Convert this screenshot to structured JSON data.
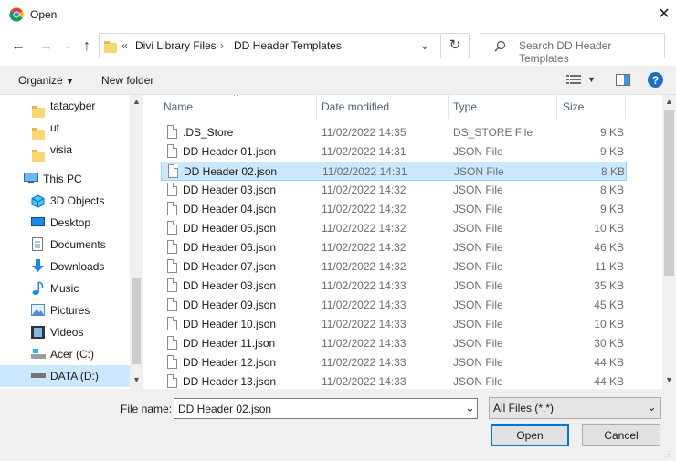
{
  "window": {
    "title": "Open",
    "close_glyph": "✕"
  },
  "nav": {
    "back": "←",
    "forward": "→",
    "up": "↑"
  },
  "address": {
    "overflow": "«",
    "segments": [
      "Divi Library Files",
      "DD Header Templates"
    ],
    "separator": "›",
    "dropdown": "⌄",
    "refresh": "↻"
  },
  "search": {
    "placeholder": "Search DD Header Templates"
  },
  "toolbar": {
    "organize": "Organize",
    "new_folder": "New folder",
    "help": "?"
  },
  "sidebar": {
    "items": [
      {
        "label": "tatacyber",
        "icon": "folder-icon"
      },
      {
        "label": "ut",
        "icon": "folder-icon"
      },
      {
        "label": "visia",
        "icon": "folder-icon"
      },
      {
        "label": "This PC",
        "icon": "computer-icon"
      },
      {
        "label": "3D Objects",
        "icon": "3d-objects-icon"
      },
      {
        "label": "Desktop",
        "icon": "desktop-icon"
      },
      {
        "label": "Documents",
        "icon": "documents-icon"
      },
      {
        "label": "Downloads",
        "icon": "downloads-icon"
      },
      {
        "label": "Music",
        "icon": "music-icon"
      },
      {
        "label": "Pictures",
        "icon": "pictures-icon"
      },
      {
        "label": "Videos",
        "icon": "videos-icon"
      },
      {
        "label": "Acer (C:)",
        "icon": "drive-icon"
      },
      {
        "label": "DATA (D:)",
        "icon": "drive-icon",
        "selected": true
      }
    ]
  },
  "columns": {
    "name": "Name",
    "date": "Date modified",
    "type": "Type",
    "size": "Size"
  },
  "files": [
    {
      "name": ".DS_Store",
      "date": "11/02/2022 14:35",
      "type": "DS_STORE File",
      "size": "9 KB"
    },
    {
      "name": "DD Header 01.json",
      "date": "11/02/2022 14:31",
      "type": "JSON File",
      "size": "9 KB"
    },
    {
      "name": "DD Header 02.json",
      "date": "11/02/2022 14:31",
      "type": "JSON File",
      "size": "8 KB",
      "selected": true
    },
    {
      "name": "DD Header 03.json",
      "date": "11/02/2022 14:32",
      "type": "JSON File",
      "size": "8 KB"
    },
    {
      "name": "DD Header 04.json",
      "date": "11/02/2022 14:32",
      "type": "JSON File",
      "size": "9 KB"
    },
    {
      "name": "DD Header 05.json",
      "date": "11/02/2022 14:32",
      "type": "JSON File",
      "size": "10 KB"
    },
    {
      "name": "DD Header 06.json",
      "date": "11/02/2022 14:32",
      "type": "JSON File",
      "size": "46 KB"
    },
    {
      "name": "DD Header 07.json",
      "date": "11/02/2022 14:32",
      "type": "JSON File",
      "size": "11 KB"
    },
    {
      "name": "DD Header 08.json",
      "date": "11/02/2022 14:33",
      "type": "JSON File",
      "size": "35 KB"
    },
    {
      "name": "DD Header 09.json",
      "date": "11/02/2022 14:33",
      "type": "JSON File",
      "size": "45 KB"
    },
    {
      "name": "DD Header 10.json",
      "date": "11/02/2022 14:33",
      "type": "JSON File",
      "size": "10 KB"
    },
    {
      "name": "DD Header 11.json",
      "date": "11/02/2022 14:33",
      "type": "JSON File",
      "size": "30 KB"
    },
    {
      "name": "DD Header 12.json",
      "date": "11/02/2022 14:33",
      "type": "JSON File",
      "size": "44 KB"
    },
    {
      "name": "DD Header 13.json",
      "date": "11/02/2022 14:33",
      "type": "JSON File",
      "size": "44 KB"
    }
  ],
  "footer": {
    "file_name_label": "File name:",
    "file_name_value": "DD Header 02.json",
    "file_type": "All Files (*.*)",
    "open": "Open",
    "cancel": "Cancel"
  },
  "colors": {
    "accent": "#0078d7",
    "selection": "#cce8ff",
    "chrome_icon": "#4285f4"
  }
}
